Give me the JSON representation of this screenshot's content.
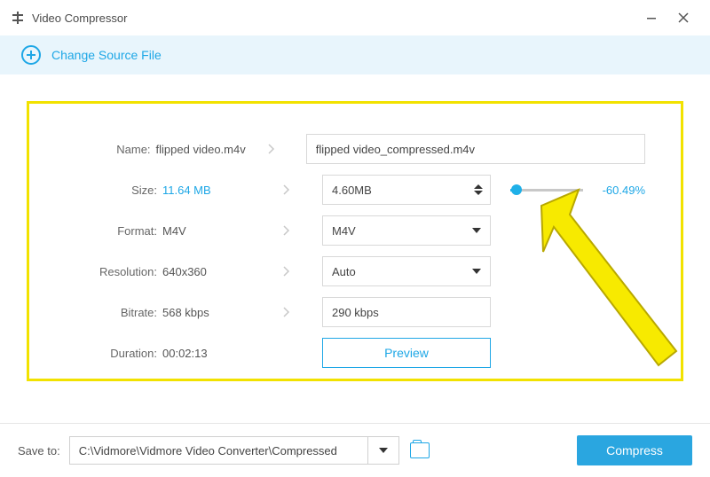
{
  "app": {
    "title": "Video Compressor"
  },
  "topbar": {
    "change_source": "Change Source File"
  },
  "labels": {
    "name": "Name:",
    "size": "Size:",
    "format": "Format:",
    "resolution": "Resolution:",
    "bitrate": "Bitrate:",
    "duration": "Duration:"
  },
  "source": {
    "name": "flipped video.m4v",
    "size": "11.64 MB",
    "format": "M4V",
    "resolution": "640x360",
    "bitrate": "568 kbps",
    "duration": "00:02:13"
  },
  "output": {
    "name": "flipped video_compressed.m4v",
    "size": "4.60MB",
    "format": "M4V",
    "resolution": "Auto",
    "bitrate": "290 kbps",
    "size_pct": "-60.49%"
  },
  "preview": "Preview",
  "bottom": {
    "save_to": "Save to:",
    "path": "C:\\Vidmore\\Vidmore Video Converter\\Compressed",
    "compress": "Compress"
  }
}
